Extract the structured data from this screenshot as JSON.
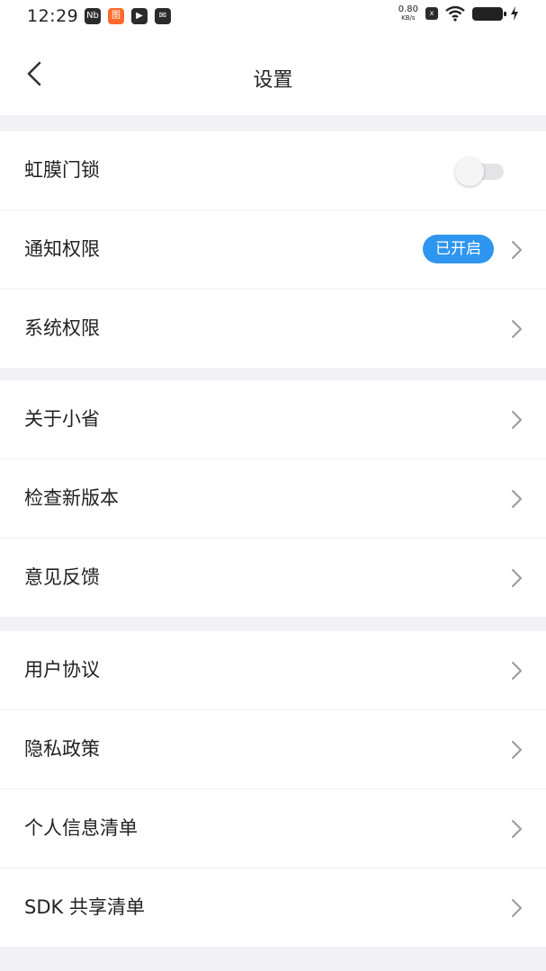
{
  "status_bar": {
    "time": "12:29",
    "app_icons": [
      "Nb",
      "图",
      "▶",
      "✉"
    ],
    "net_speed_value": "0.80",
    "net_speed_unit": "KB/s",
    "sim_icon": "x"
  },
  "header": {
    "title": "设置"
  },
  "groups": [
    {
      "items": [
        {
          "label": "虹膜门锁",
          "control": "toggle",
          "toggle_on": false
        },
        {
          "label": "通知权限",
          "badge": "已开启"
        },
        {
          "label": "系统权限"
        }
      ]
    },
    {
      "items": [
        {
          "label": "关于小省"
        },
        {
          "label": "检查新版本"
        },
        {
          "label": "意见反馈"
        }
      ]
    },
    {
      "items": [
        {
          "label": "用户协议"
        },
        {
          "label": "隐私政策"
        },
        {
          "label": "个人信息清单"
        },
        {
          "label": "SDK 共享清单"
        }
      ]
    }
  ],
  "colors": {
    "background": "#f2f2f6",
    "card": "#ffffff",
    "badge": "#2f96f0",
    "toggle_off_track": "#e4e4e6"
  }
}
